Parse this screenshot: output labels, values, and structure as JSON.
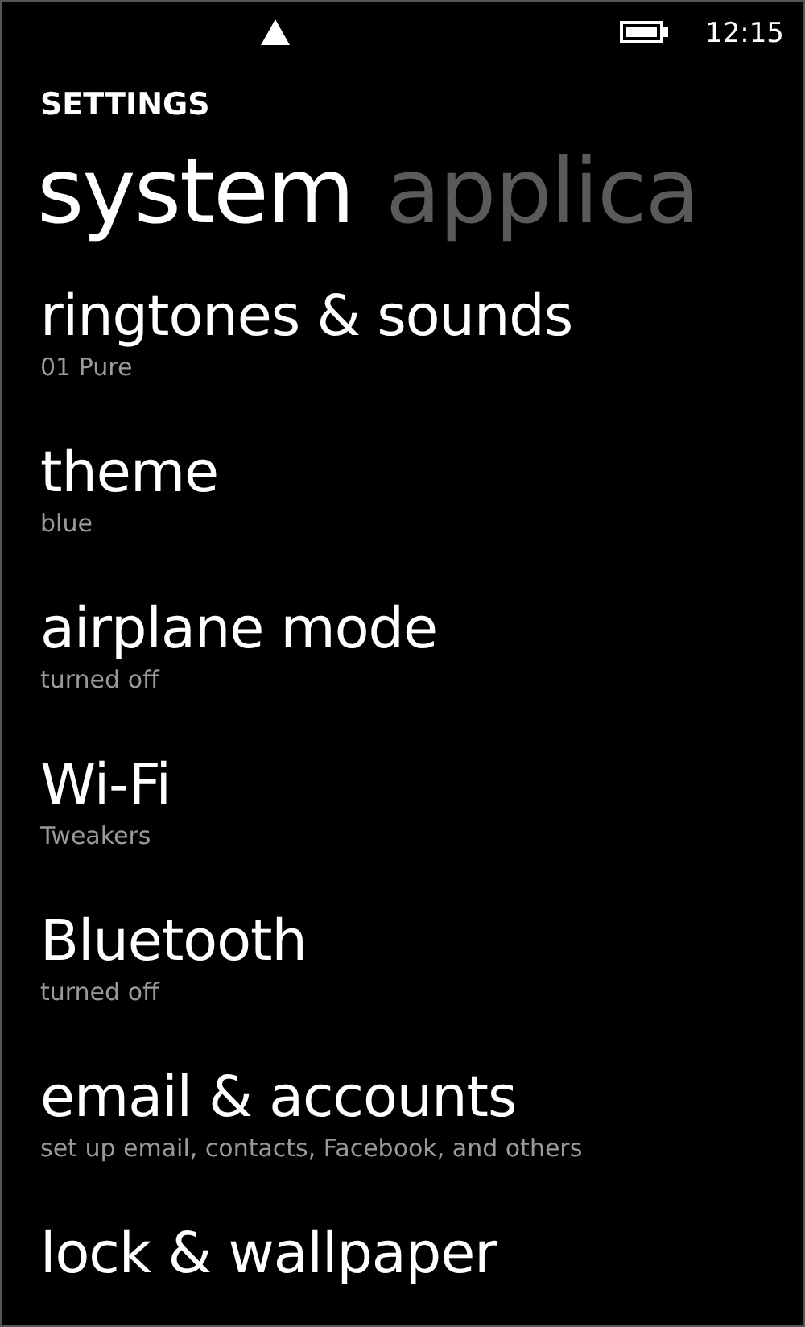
{
  "status_bar": {
    "time": "12:15"
  },
  "title": "SETTINGS",
  "pivots": [
    {
      "label": "system",
      "selected": true
    },
    {
      "label": "applica",
      "selected": false
    }
  ],
  "items": [
    {
      "title": "ringtones & sounds",
      "subtitle": "01 Pure"
    },
    {
      "title": "theme",
      "subtitle": "blue"
    },
    {
      "title": "airplane mode",
      "subtitle": "turned off"
    },
    {
      "title": "Wi-Fi",
      "subtitle": "Tweakers"
    },
    {
      "title": "Bluetooth",
      "subtitle": "turned off"
    },
    {
      "title": "email & accounts",
      "subtitle": "set up email, contacts, Facebook, and others"
    },
    {
      "title": "lock & wallpaper"
    }
  ]
}
